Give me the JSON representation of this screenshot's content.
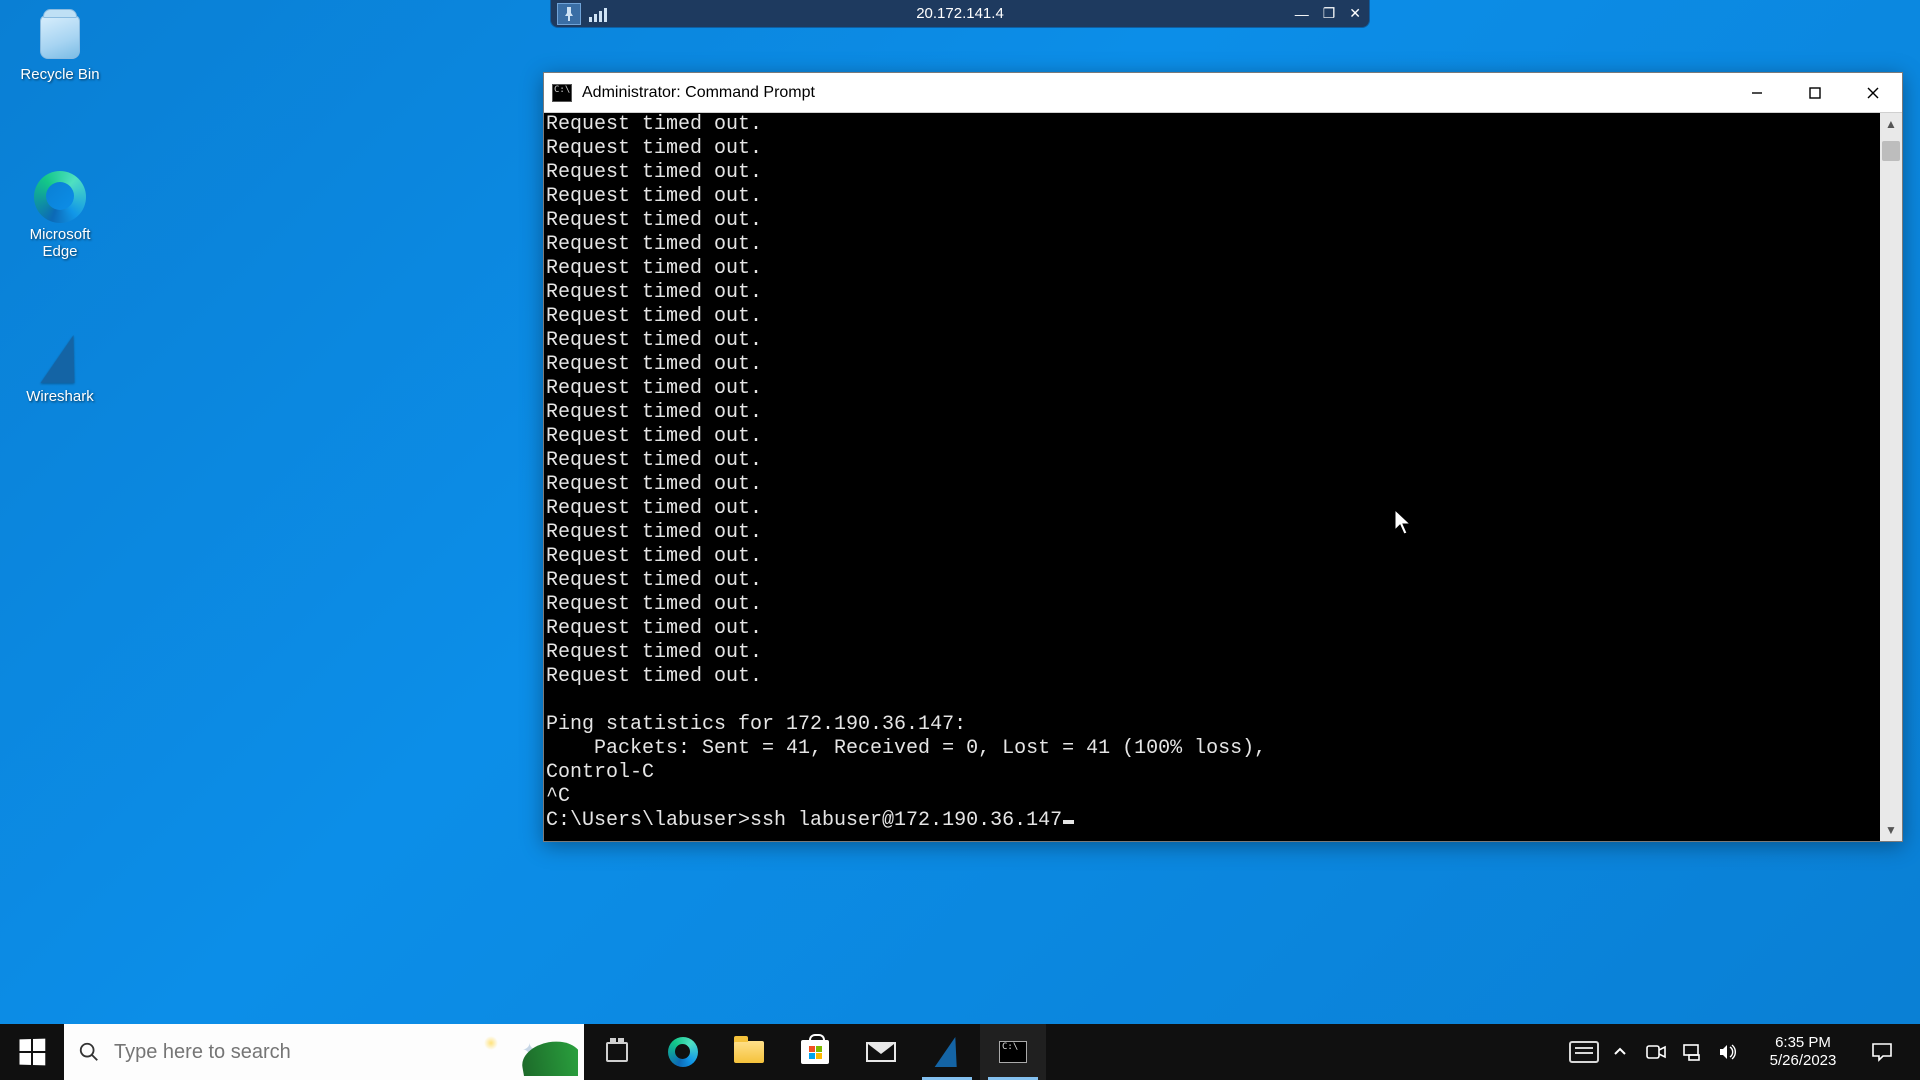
{
  "remote_bar": {
    "ip": "20.172.141.4"
  },
  "desktop_icons": {
    "recycle": "Recycle Bin",
    "edge": "Microsoft\nEdge",
    "wireshark": "Wireshark"
  },
  "cmd_window": {
    "title": "Administrator: Command Prompt",
    "timeout_line": "Request timed out.",
    "timeout_count": 24,
    "stats_header": "Ping statistics for 172.190.36.147:",
    "stats_packets": "    Packets: Sent = 41, Received = 0, Lost = 41 (100% loss),",
    "ctrl_c": "Control-C",
    "caret_c": "^C",
    "prompt": "C:\\Users\\labuser>",
    "typed": "ssh labuser@172.190.36.147"
  },
  "taskbar": {
    "search_placeholder": "Type here to search",
    "clock_time": "6:35 PM",
    "clock_date": "5/26/2023"
  }
}
